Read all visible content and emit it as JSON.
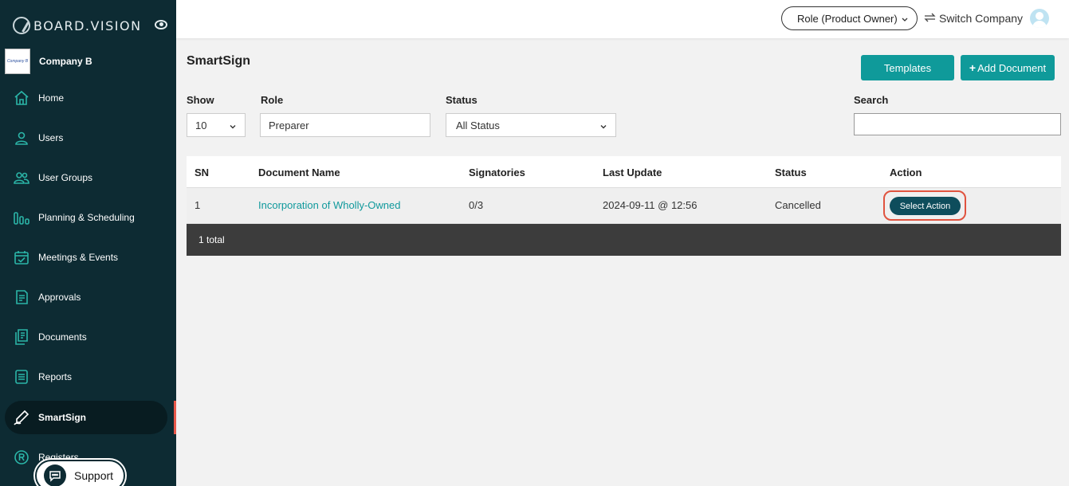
{
  "sidebar": {
    "brand": "BOARD.VISION",
    "company_logo_text": "Company B",
    "company_name": "Company B",
    "items": [
      {
        "label": "Home",
        "icon": "home-icon"
      },
      {
        "label": "Users",
        "icon": "user-icon"
      },
      {
        "label": "User Groups",
        "icon": "user-group-icon"
      },
      {
        "label": "Planning & Scheduling",
        "icon": "bar-chart-icon"
      },
      {
        "label": "Meetings & Events",
        "icon": "calendar-check-icon"
      },
      {
        "label": "Approvals",
        "icon": "document-check-icon"
      },
      {
        "label": "Documents",
        "icon": "documents-icon"
      },
      {
        "label": "Reports",
        "icon": "report-icon"
      },
      {
        "label": "SmartSign",
        "icon": "pen-sign-icon",
        "active": true
      },
      {
        "label": "Registers",
        "icon": "registered-icon"
      }
    ],
    "support_label": "Support"
  },
  "topbar": {
    "role": "Role (Product Owner)",
    "switch_company": "Switch Company"
  },
  "main": {
    "title": "SmartSign",
    "templates_button": "Templates",
    "add_document_button": "Add Document",
    "filters": {
      "show_label": "Show",
      "show_value": "10",
      "role_label": "Role",
      "role_value": "Preparer",
      "status_label": "Status",
      "status_value": "All Status",
      "search_label": "Search",
      "search_value": ""
    },
    "table": {
      "headers": [
        "SN",
        "Document Name",
        "Signatories",
        "Last Update",
        "Status",
        "Action"
      ],
      "rows": [
        {
          "sn": "1",
          "document_name": "Incorporation of Wholly-Owned",
          "signatories": "0/3",
          "last_update": "2024-09-11 @ 12:56",
          "status": "Cancelled",
          "action": "Select Action"
        }
      ],
      "footer": "1 total"
    }
  },
  "colors": {
    "sidebar_bg": "#0d2b33",
    "accent_teal": "#0f9a9a",
    "action_button": "#0e4d5c",
    "highlight_red": "#e0533f",
    "link": "#10999c"
  }
}
